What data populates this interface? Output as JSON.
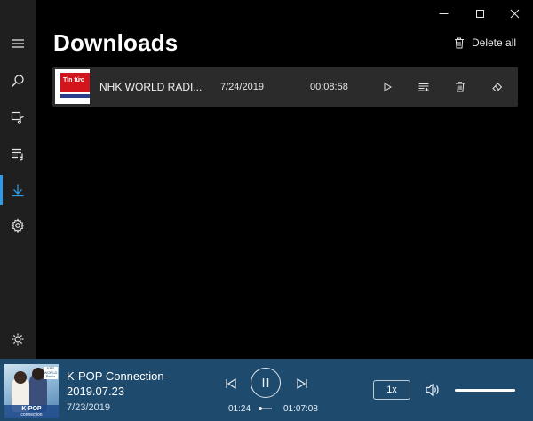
{
  "window": {
    "controls": [
      {
        "name": "minimize-icon"
      },
      {
        "name": "maximize-icon"
      },
      {
        "name": "close-icon"
      }
    ]
  },
  "sidebar": {
    "items": [
      {
        "icon": "hamburger-menu-icon"
      },
      {
        "icon": "search-icon"
      },
      {
        "icon": "podcast-library-icon"
      },
      {
        "icon": "playlist-icon"
      },
      {
        "icon": "download-icon",
        "active": true
      },
      {
        "icon": "gear-icon"
      },
      {
        "icon": "brightness-icon"
      }
    ],
    "accent_color": "#2f9be8"
  },
  "page": {
    "title": "Downloads",
    "delete_all_label": "Delete all"
  },
  "downloads": [
    {
      "thumbnail_text": "Tin tức",
      "title": "NHK WORLD RADI...",
      "date": "7/24/2019",
      "duration": "00:08:58",
      "actions": [
        "play-icon",
        "add-to-queue-icon",
        "trash-icon",
        "eraser-icon"
      ]
    }
  ],
  "player": {
    "art_caption": "K-POP",
    "art_caption_sub": "connection",
    "art_badge": "KBS WORLD Radio",
    "title": "K-POP Connection - 2019.07.23",
    "date": "7/23/2019",
    "elapsed": "01:24",
    "total": "01:07:08",
    "progress_fraction": 0.021,
    "speed": "1x",
    "volume_fraction": 1.0,
    "background_color": "#1e4a6d"
  }
}
